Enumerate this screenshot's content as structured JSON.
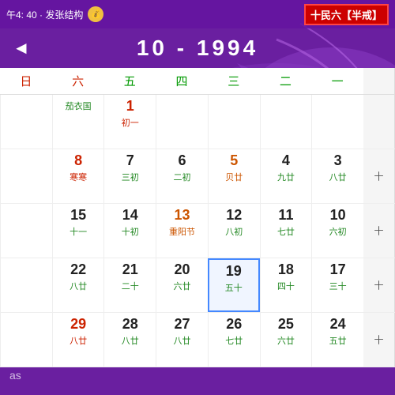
{
  "header": {
    "title": "十民六【半戒】",
    "time": "午4: 40 · 发张结构",
    "coin_symbol": "🪙"
  },
  "nav": {
    "year_month": "1994 - 10",
    "arrow_left": "◄"
  },
  "weekdays": [
    {
      "label": "一",
      "color": "normal"
    },
    {
      "label": "二",
      "color": "normal"
    },
    {
      "label": "三",
      "color": "normal"
    },
    {
      "label": "四",
      "color": "normal"
    },
    {
      "label": "五",
      "color": "normal"
    },
    {
      "label": "六",
      "color": "red"
    },
    {
      "label": "日",
      "color": "red"
    }
  ],
  "rows": [
    {
      "label": "",
      "cells": [
        {
          "main": "",
          "sub": "",
          "style": "normal"
        },
        {
          "main": "",
          "sub": "",
          "style": "normal"
        },
        {
          "main": "",
          "sub": "",
          "style": "normal"
        },
        {
          "main": "",
          "sub": "",
          "style": "normal"
        },
        {
          "main": "1",
          "sub": "初一",
          "style": "red"
        },
        {
          "main": "",
          "sub": "茄衣国",
          "style": "normal",
          "holiday": ""
        },
        {
          "main": "",
          "sub": "",
          "style": "normal"
        }
      ]
    },
    {
      "label": "十",
      "cells": [
        {
          "main": "3",
          "sub": "八廿",
          "style": "normal"
        },
        {
          "main": "4",
          "sub": "九廿",
          "style": "normal"
        },
        {
          "main": "5",
          "sub": "贝廿",
          "style": "orange"
        },
        {
          "main": "6",
          "sub": "二初",
          "style": "normal"
        },
        {
          "main": "7",
          "sub": "三初",
          "style": "normal"
        },
        {
          "main": "8",
          "sub": "寒寒",
          "style": "red"
        },
        {
          "main": "",
          "sub": "",
          "style": "normal"
        }
      ]
    },
    {
      "label": "十",
      "cells": [
        {
          "main": "10",
          "sub": "六初",
          "style": "normal"
        },
        {
          "main": "11",
          "sub": "七廿",
          "style": "normal"
        },
        {
          "main": "12",
          "sub": "八初",
          "style": "normal"
        },
        {
          "main": "13",
          "sub": "重阳节",
          "style": "orange"
        },
        {
          "main": "14",
          "sub": "十初",
          "style": "normal"
        },
        {
          "main": "15",
          "sub": "十一",
          "style": "normal"
        },
        {
          "main": "",
          "sub": "",
          "style": "normal"
        }
      ]
    },
    {
      "label": "十",
      "cells": [
        {
          "main": "17",
          "sub": "三十",
          "style": "normal"
        },
        {
          "main": "18",
          "sub": "四十",
          "style": "normal"
        },
        {
          "main": "19",
          "sub": "五十",
          "style": "highlighted",
          "highlighted": true
        },
        {
          "main": "20",
          "sub": "六廿",
          "style": "normal"
        },
        {
          "main": "21",
          "sub": "二十",
          "style": "normal"
        },
        {
          "main": "22",
          "sub": "八廿",
          "style": "normal"
        },
        {
          "main": "",
          "sub": "",
          "style": "normal"
        }
      ]
    },
    {
      "label": "十",
      "cells": [
        {
          "main": "24",
          "sub": "五廿",
          "style": "normal"
        },
        {
          "main": "25",
          "sub": "六廿",
          "style": "normal"
        },
        {
          "main": "26",
          "sub": "七廿",
          "style": "normal"
        },
        {
          "main": "27",
          "sub": "八廿",
          "style": "normal"
        },
        {
          "main": "28",
          "sub": "八廿",
          "style": "normal"
        },
        {
          "main": "29",
          "sub": "八廿",
          "style": "red"
        },
        {
          "main": "",
          "sub": "",
          "style": "normal"
        }
      ]
    }
  ],
  "footer": {
    "text": "as"
  }
}
